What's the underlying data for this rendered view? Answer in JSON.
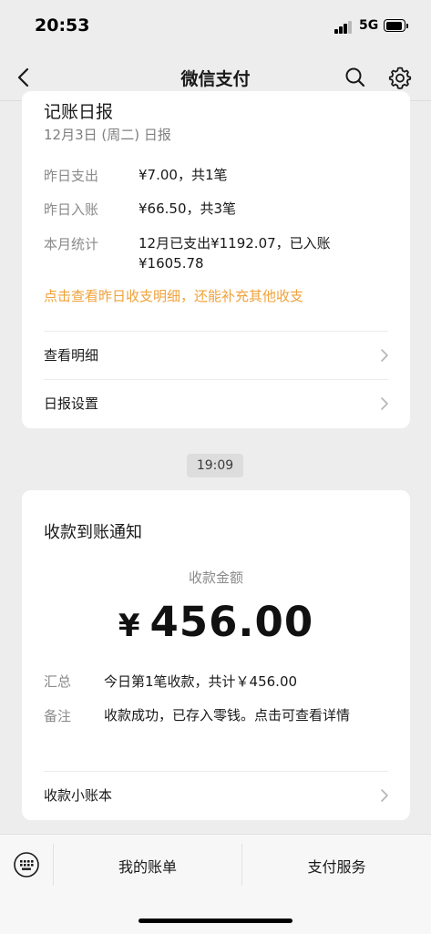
{
  "status_bar": {
    "time": "20:53",
    "network": "5G"
  },
  "nav": {
    "title": "微信支付"
  },
  "daily_report": {
    "title": "记账日报",
    "date": "12月3日 (周二) 日报",
    "rows": [
      {
        "label": "昨日支出",
        "value": "¥7.00，共1笔"
      },
      {
        "label": "昨日入账",
        "value": "¥66.50，共3笔"
      },
      {
        "label": "本月统计",
        "value": "12月已支出¥1192.07，已入账¥1605.78"
      }
    ],
    "prompt_link": "点击查看昨日收支明细，还能补充其他收支",
    "actions": [
      {
        "label": "查看明细"
      },
      {
        "label": "日报设置"
      }
    ]
  },
  "timestamp": "19:09",
  "receipt": {
    "title": "收款到账通知",
    "amount_label": "收款金额",
    "currency": "¥",
    "amount": "456.00",
    "details": [
      {
        "label": "汇总",
        "value": "今日第1笔收款，共计￥456.00"
      },
      {
        "label": "备注",
        "value": "收款成功，已存入零钱。点击可查看详情"
      }
    ],
    "action": "收款小账本"
  },
  "bottom_bar": {
    "items": [
      "我的账单",
      "支付服务"
    ]
  },
  "colors": {
    "accent": "#f0a23a",
    "background": "#ededed",
    "card": "#ffffff"
  },
  "icons": [
    "back-icon",
    "search-icon",
    "gear-icon",
    "chevron-right-icon",
    "keyboard-icon"
  ]
}
